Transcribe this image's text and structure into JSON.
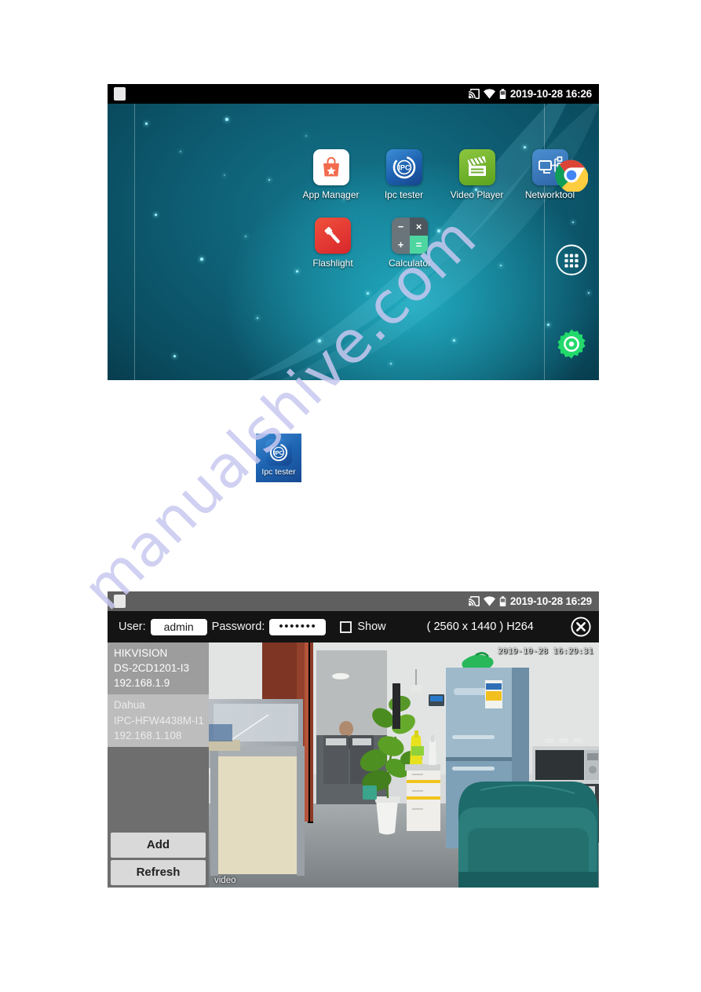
{
  "watermark": {
    "text": "manualshive.com"
  },
  "home_screen": {
    "statusbar": {
      "clock": "2019-10-28 16:26",
      "icons": [
        "cast-icon",
        "wifi-icon",
        "battery-icon"
      ]
    },
    "apps": [
      {
        "label": "App Manager",
        "icon": "app-manager-icon"
      },
      {
        "label": "Ipc tester",
        "icon": "ipc-tester-icon"
      },
      {
        "label": "Video Player",
        "icon": "video-player-icon"
      },
      {
        "label": "Networktool",
        "icon": "networktool-icon"
      },
      {
        "label": "Flashlight",
        "icon": "flashlight-icon"
      },
      {
        "label": "Calculator",
        "icon": "calculator-icon"
      }
    ],
    "calculator_keys": {
      "minus": "−",
      "times": "×",
      "plus": "+",
      "equals": "="
    },
    "ipc_badge_text": "IPC",
    "dock": [
      {
        "name": "chrome-icon"
      },
      {
        "name": "app-drawer-icon"
      },
      {
        "name": "settings-gear-icon"
      }
    ]
  },
  "sample_icon": {
    "label": "Ipc tester",
    "badge_text": "IPC"
  },
  "ipc_app": {
    "statusbar": {
      "clock": "2019-10-28 16:29",
      "icons": [
        "cast-icon",
        "wifi-icon",
        "battery-icon"
      ]
    },
    "toolbar": {
      "user_label": "User:",
      "user_value": "admin",
      "password_label": "Password:",
      "password_value": "•••••••",
      "show_label": "Show",
      "show_checked": false,
      "resolution": "( 2560 x 1440 ) H264",
      "close_icon": "close-circle-icon"
    },
    "devices": [
      {
        "vendor": "HIKVISION",
        "model": "DS-2CD1201-I3",
        "ip": "192.168.1.9",
        "selected": true
      },
      {
        "vendor": "Dahua",
        "model": "IPC-HFW4438M-I1",
        "ip": "192.168.1.108",
        "selected": false
      }
    ],
    "buttons": {
      "add": "Add",
      "refresh": "Refresh"
    },
    "video": {
      "osd_timestamp": "2019-10-28 16:29:31",
      "osd_label": "video"
    },
    "bottom_bar": [
      {
        "name": "record-video-icon"
      },
      {
        "name": "snapshot-camera-icon"
      },
      {
        "name": "playback-play-icon"
      },
      {
        "name": "audio-volume-icon"
      },
      {
        "name": "onvif-chat-icon"
      },
      {
        "name": "settings-gear-icon"
      },
      {
        "name": "hd-monitor-icon"
      },
      {
        "name": "rtsp-monitor-icon"
      }
    ]
  },
  "colors": {
    "status_dark": "#000000",
    "status_gray": "#5f5f5f",
    "toolbar_black": "#141414",
    "panel_gray": "#6e6e6e",
    "panel_selected": "#9d9d9d",
    "panel_item": "#bdbdbd",
    "button_face": "#d9d9d9",
    "wallpaper_teal": "#12788f",
    "watermark": "#c8c8f0"
  }
}
